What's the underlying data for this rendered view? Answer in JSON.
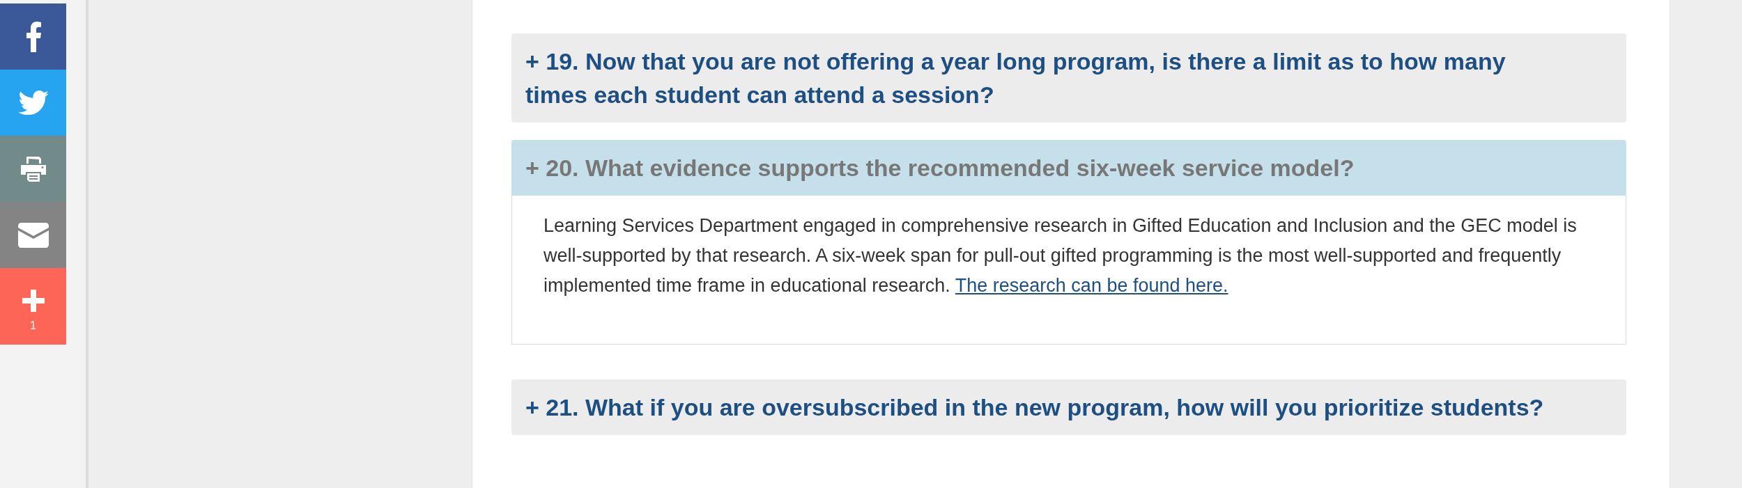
{
  "share_buttons": [
    {
      "kind": "facebook"
    },
    {
      "kind": "twitter"
    },
    {
      "kind": "print"
    },
    {
      "kind": "email"
    },
    {
      "kind": "more",
      "count": "1"
    }
  ],
  "faq": [
    {
      "question": "+ 19. Now that you are not offering a year long program, is there a limit as to how many times each student can attend a session?",
      "expanded": false
    },
    {
      "question": "+ 20. What evidence supports the recommended six-week service model?",
      "expanded": true,
      "answer": "Learning Services Department engaged in comprehensive research in Gifted Education and Inclusion and the GEC model is well-supported by that research. A six-week span for pull-out gifted programming is the most well-supported and frequently implemented time frame in educational research.",
      "link": "The research can be found here."
    },
    {
      "question": "+ 21. What if you are oversubscribed in the new program, how will you prioritize students?",
      "expanded": false
    }
  ]
}
